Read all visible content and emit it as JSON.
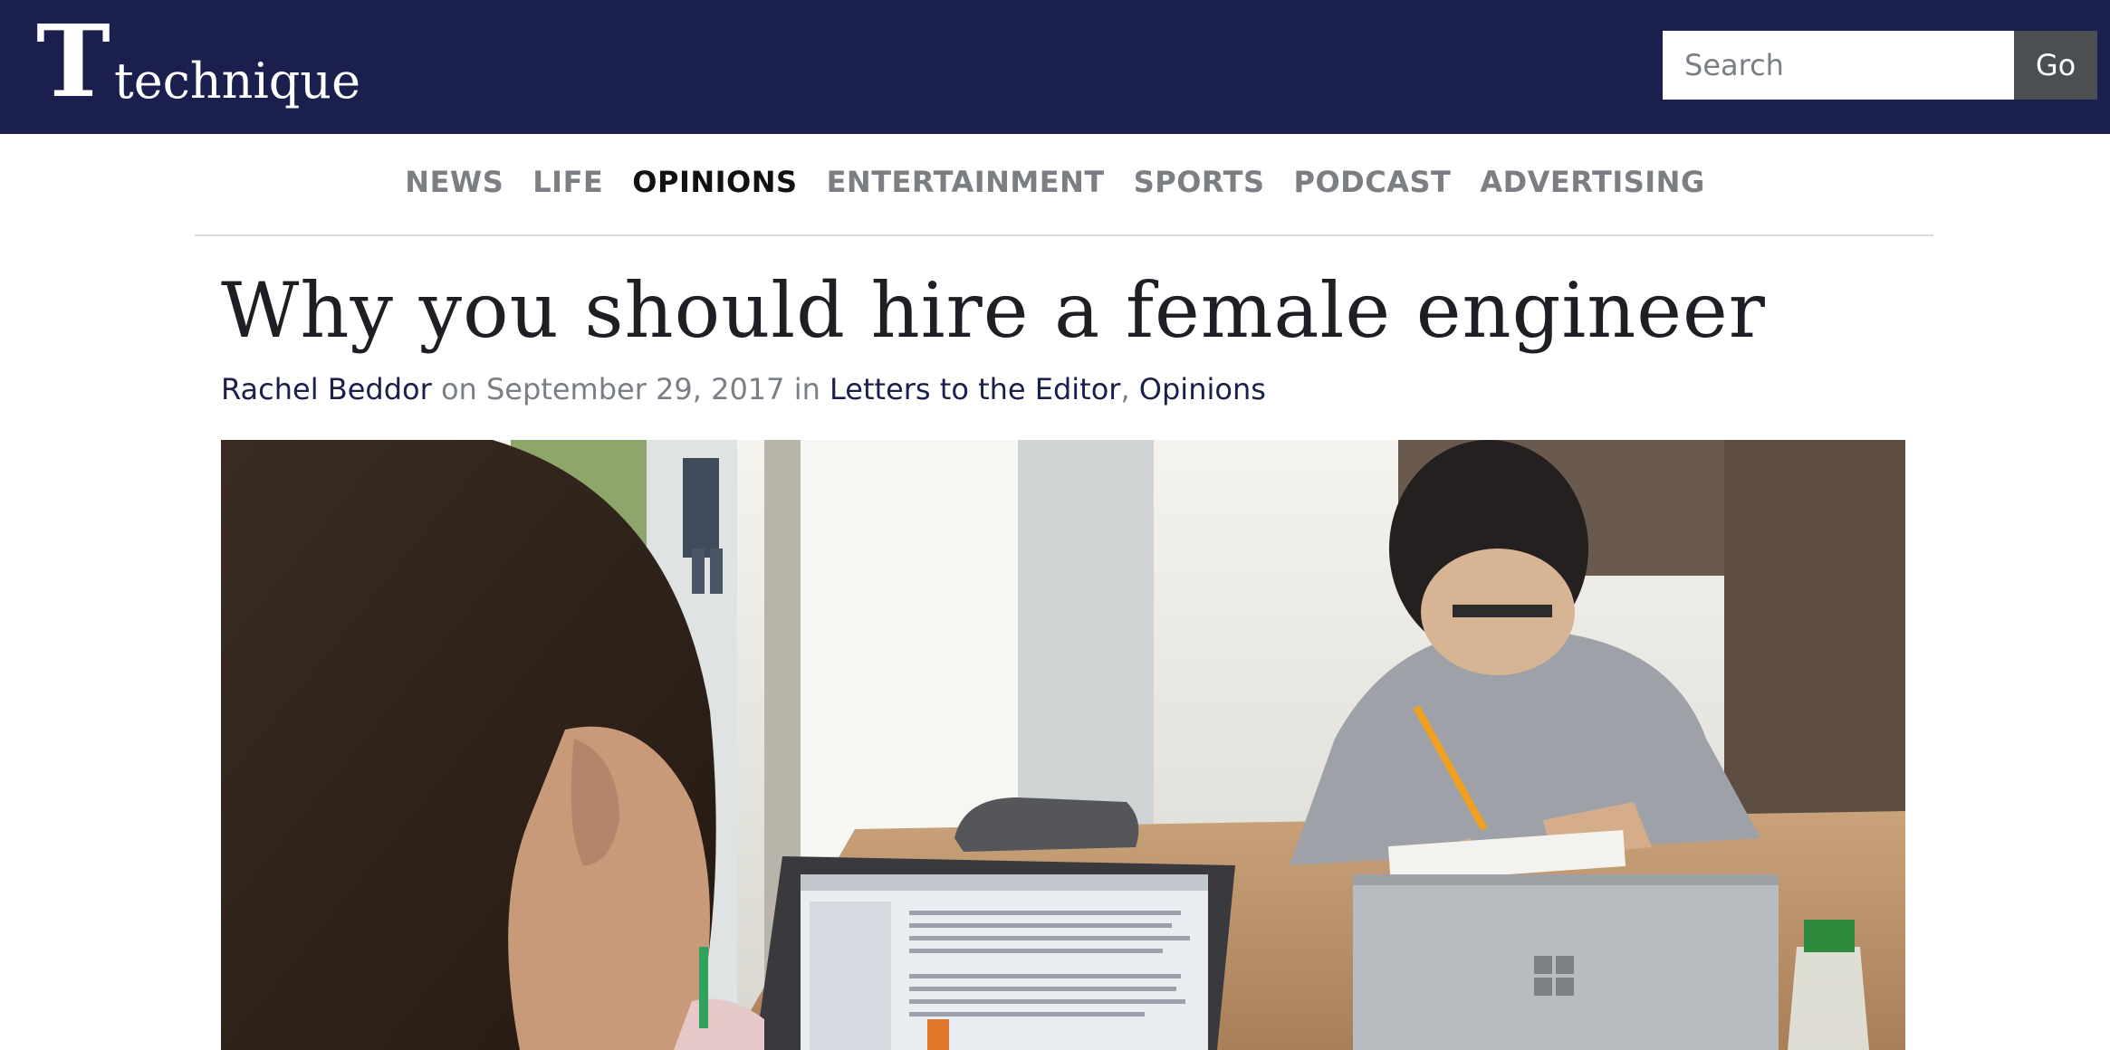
{
  "site": {
    "logo_mark": "T",
    "name": "technique"
  },
  "search": {
    "placeholder": "Search",
    "button_label": "Go"
  },
  "nav": {
    "items": [
      {
        "label": "NEWS",
        "active": false
      },
      {
        "label": "LIFE",
        "active": false
      },
      {
        "label": "OPINIONS",
        "active": true
      },
      {
        "label": "ENTERTAINMENT",
        "active": false
      },
      {
        "label": "SPORTS",
        "active": false
      },
      {
        "label": "PODCAST",
        "active": false
      },
      {
        "label": "ADVERTISING",
        "active": false
      }
    ]
  },
  "article": {
    "title": "Why you should hire a female engineer",
    "author": "Rachel Beddor",
    "on_text": " on ",
    "date": "September 29, 2017",
    "in_text": " in ",
    "category_1": "Letters to the Editor",
    "separator": ", ",
    "category_2": "Opinions"
  },
  "colors": {
    "header_bg": "#1b1f4d",
    "nav_active": "#111111",
    "nav_inactive": "#7b7e83",
    "link": "#1b1f4d",
    "button_bg": "#4b4e52"
  }
}
